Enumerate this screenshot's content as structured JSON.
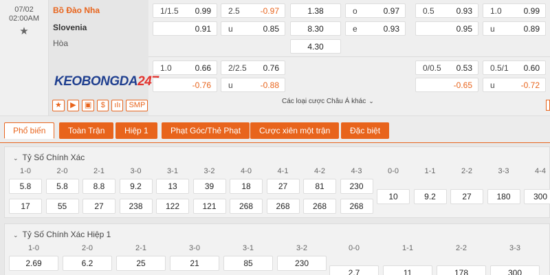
{
  "match": {
    "date": "07/02",
    "time": "02:00AM",
    "home": "Bồ Đào Nha",
    "away": "Slovenia",
    "draw": "Hòa",
    "logo_part1": "KEOBONGDA",
    "logo_part2": "247",
    "icons": [
      {
        "name": "star-icon",
        "glyph": "★"
      },
      {
        "name": "play-icon",
        "glyph": "▶"
      },
      {
        "name": "tv-icon",
        "glyph": "▣"
      },
      {
        "name": "dollar-icon",
        "glyph": "$"
      },
      {
        "name": "stats-icon",
        "glyph": "ıIı"
      },
      {
        "name": "smp-label",
        "glyph": "SMP"
      }
    ],
    "more_bets": "Các loại cược Châu Á khác"
  },
  "odds": {
    "r1": {
      "hdp": "1/1.5",
      "hdp_home": "0.99",
      "ou": "2.5",
      "ou_over": "-0.97",
      "x12_home": "1.38",
      "o_label": "o",
      "o_val": "0.97",
      "h1_hdp": "0.5",
      "h1_home": "0.93",
      "h1_ou": "1.0",
      "h1_over": "0.99"
    },
    "r2": {
      "hdp_away": "0.91",
      "u_label": "u",
      "ou_under": "0.85",
      "x12_away": "8.30",
      "e_label": "e",
      "e_val": "0.93",
      "h1_away": "0.95",
      "u2_label": "u",
      "h1_under": "0.89"
    },
    "r3": {
      "x12_draw": "4.30"
    },
    "r4": {
      "hdp": "1.0",
      "hdp_home": "0.66",
      "ou": "2/2.5",
      "ou_over": "0.76",
      "h1_hdp": "0/0.5",
      "h1_home": "0.53",
      "h1_ou": "0.5/1",
      "h1_over": "0.60"
    },
    "r5": {
      "hdp_away": "-0.76",
      "u_label": "u",
      "ou_under": "-0.88",
      "h1_away": "-0.65",
      "u2_label": "u",
      "h1_under": "-0.72"
    }
  },
  "tabs": [
    "Phổ biến",
    "Toàn Trận",
    "Hiệp 1",
    "Phạt Góc/Thẻ Phạt",
    "Cược xiên một trận",
    "Đặc biệt"
  ],
  "section1": {
    "title": "Tỷ Số Chính Xác",
    "home_scores": [
      "1-0",
      "2-0",
      "2-1",
      "3-0",
      "3-1",
      "3-2",
      "4-0",
      "4-1",
      "4-2",
      "4-3"
    ],
    "home_odds": [
      "5.8",
      "5.8",
      "8.8",
      "9.2",
      "13",
      "39",
      "18",
      "27",
      "81",
      "230"
    ],
    "away_odds": [
      "17",
      "55",
      "27",
      "238",
      "122",
      "121",
      "268",
      "268",
      "268",
      "268"
    ],
    "draw_scores": [
      "0-0",
      "1-1",
      "2-2",
      "3-3",
      "4-4"
    ],
    "draw_odds": [
      "10",
      "9.2",
      "27",
      "180",
      "300"
    ]
  },
  "section2": {
    "title": "Tỷ Số Chính Xác Hiệp 1",
    "home_scores": [
      "1-0",
      "2-0",
      "2-1",
      "3-0",
      "3-1",
      "3-2"
    ],
    "home_odds": [
      "2.69",
      "6.2",
      "25",
      "21",
      "85",
      "230"
    ],
    "draw_scores": [
      "0-0",
      "1-1",
      "2-2",
      "3-3"
    ],
    "draw_odds": [
      "2.7",
      "11",
      "178",
      "300"
    ]
  }
}
